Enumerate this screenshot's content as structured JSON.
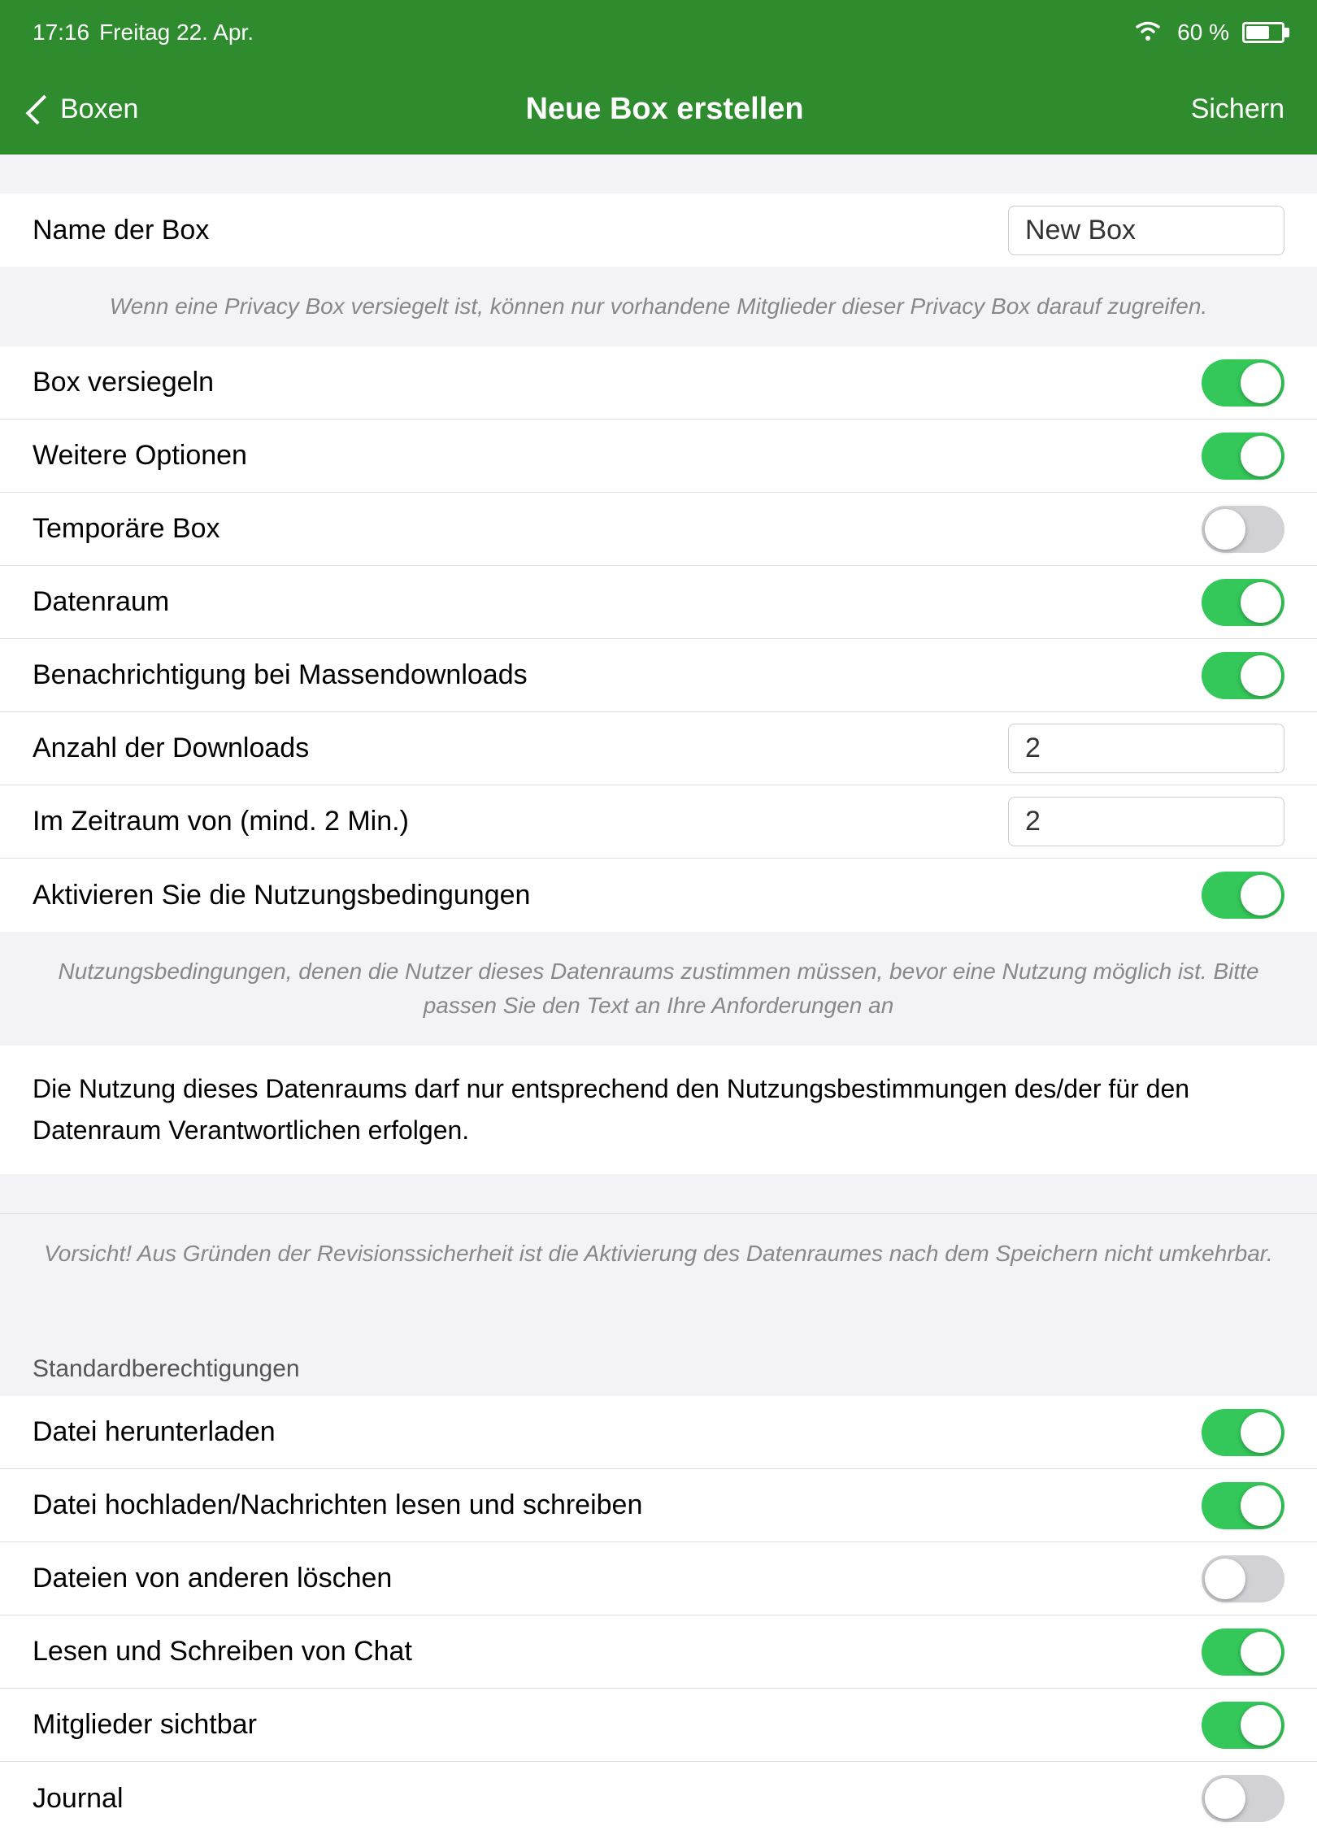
{
  "statusBar": {
    "time": "17:16",
    "date": "Freitag 22. Apr.",
    "battery": "60 %",
    "wifiIcon": "wifi"
  },
  "navBar": {
    "backLabel": "Boxen",
    "title": "Neue Box erstellen",
    "actionLabel": "Sichern"
  },
  "nameField": {
    "label": "Name der Box",
    "value": "New Box"
  },
  "privacyHint": "Wenn eine Privacy Box versiegelt ist, können nur vorhandene Mitglieder dieser Privacy Box darauf zugreifen.",
  "toggles": {
    "boxVersiegeln": {
      "label": "Box versiegeln",
      "on": true
    },
    "weitereOptionen": {
      "label": "Weitere Optionen",
      "on": true
    },
    "temporaereBox": {
      "label": "Temporäre Box",
      "on": false
    },
    "datenraum": {
      "label": "Datenraum",
      "on": true
    },
    "benachrichtigung": {
      "label": "Benachrichtigung bei Massendownloads",
      "on": true
    }
  },
  "downloadFields": {
    "anzahlLabel": "Anzahl der Downloads",
    "anzahlValue": "2",
    "zeitraumLabel": "Im Zeitraum von (mind. 2 Min.)",
    "zeitraumValue": "2"
  },
  "nutzungsbedingungen": {
    "toggleLabel": "Aktivieren Sie die Nutzungsbedingungen",
    "on": true,
    "hint": "Nutzungsbedingungen, denen die Nutzer dieses Datenraums zustimmen müssen, bevor eine Nutzung möglich ist. Bitte passen Sie den Text an Ihre Anforderungen an",
    "text": "Die Nutzung dieses Datenraums darf nur entsprechend den Nutzungsbestimmungen des/der für den Datenraum Verantwortlichen erfolgen."
  },
  "warningText": "Vorsicht! Aus Gründen der Revisionssicherheit ist die Aktivierung des Datenraumes nach dem Speichern nicht umkehrbar.",
  "standardberechtigungen": {
    "header": "Standardberechtigungen",
    "items": [
      {
        "label": "Datei herunterladen",
        "on": true
      },
      {
        "label": "Datei hochladen/Nachrichten lesen und schreiben",
        "on": true
      },
      {
        "label": "Dateien von anderen löschen",
        "on": false
      },
      {
        "label": "Lesen und Schreiben von Chat",
        "on": true
      },
      {
        "label": "Mitglieder sichtbar",
        "on": true
      },
      {
        "label": "Journal",
        "on": false
      }
    ]
  }
}
